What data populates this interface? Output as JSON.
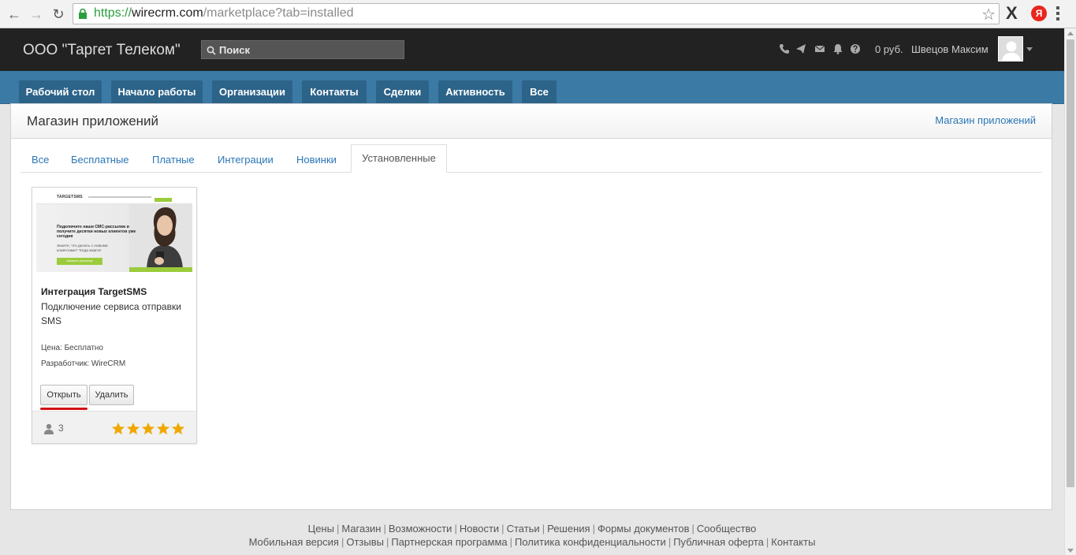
{
  "browser": {
    "url_scheme": "https://",
    "url_host": "wirecrm.com",
    "url_path": "/marketplace?tab=installed",
    "ext_x": "X",
    "ext_ya": "Я"
  },
  "header": {
    "company": "ООО \"Таргет Телеком\"",
    "search_placeholder": "Поиск",
    "balance": "0 руб.",
    "user": "Швецов Максим"
  },
  "nav": {
    "items": [
      {
        "label": "Рабочий стол"
      },
      {
        "label": "Начало работы"
      },
      {
        "label": "Организации"
      },
      {
        "label": "Контакты"
      },
      {
        "label": "Сделки"
      },
      {
        "label": "Активность"
      },
      {
        "label": "Все"
      }
    ]
  },
  "page": {
    "title": "Магазин приложений",
    "header_link": "Магазин приложений",
    "tabs": [
      {
        "label": "Все"
      },
      {
        "label": "Бесплатные"
      },
      {
        "label": "Платные"
      },
      {
        "label": "Интеграции"
      },
      {
        "label": "Новинки"
      },
      {
        "label": "Установленные"
      }
    ],
    "active_tab": "Установленные"
  },
  "card": {
    "thumbnail": {
      "logo": "TARGETSMS",
      "headline": "Подключите наши СМС-рассылки и получите десятки новых клиентов уже сегодня",
      "subtext": "Знаете, что делать с новыми клиентами? Тогда жмите!",
      "button": "Заказать рассылку"
    },
    "title": "Интеграция TargetSMS",
    "description": "Подключение сервиса отправки SMS",
    "price": "Цена: Бесплатно",
    "developer": "Разработчик: WireCRM",
    "open_label": "Открыть",
    "delete_label": "Удалить",
    "users_count": "3",
    "rating": 5
  },
  "footer": {
    "row1": [
      "Цены",
      "Магазин",
      "Возможности",
      "Новости",
      "Статьи",
      "Решения",
      "Формы документов",
      "Сообщество"
    ],
    "row2": [
      "Мобильная версия",
      "Отзывы",
      "Партнерская программа",
      "Политика конфиденциальности",
      "Публичная оферта",
      "Контакты"
    ]
  },
  "colors": {
    "nav_bar": "#3b7aa5",
    "nav_tab": "#2c6389",
    "link": "#2a76b6",
    "star": "#f0a800",
    "highlight": "#d20f14"
  }
}
